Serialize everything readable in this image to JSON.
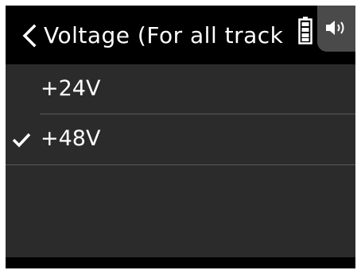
{
  "header": {
    "title": "Voltage (For all track",
    "back_icon": "chevron-left-icon",
    "battery_icon": "battery-icon",
    "speaker_icon": "speaker-icon"
  },
  "options": [
    {
      "label": "+24V",
      "selected": false
    },
    {
      "label": "+48V",
      "selected": true
    }
  ],
  "colors": {
    "background": "#000000",
    "list_background": "#2b2b2b",
    "text": "#ffffff",
    "tab": "#4a4a4a",
    "check": "#ffffff"
  }
}
